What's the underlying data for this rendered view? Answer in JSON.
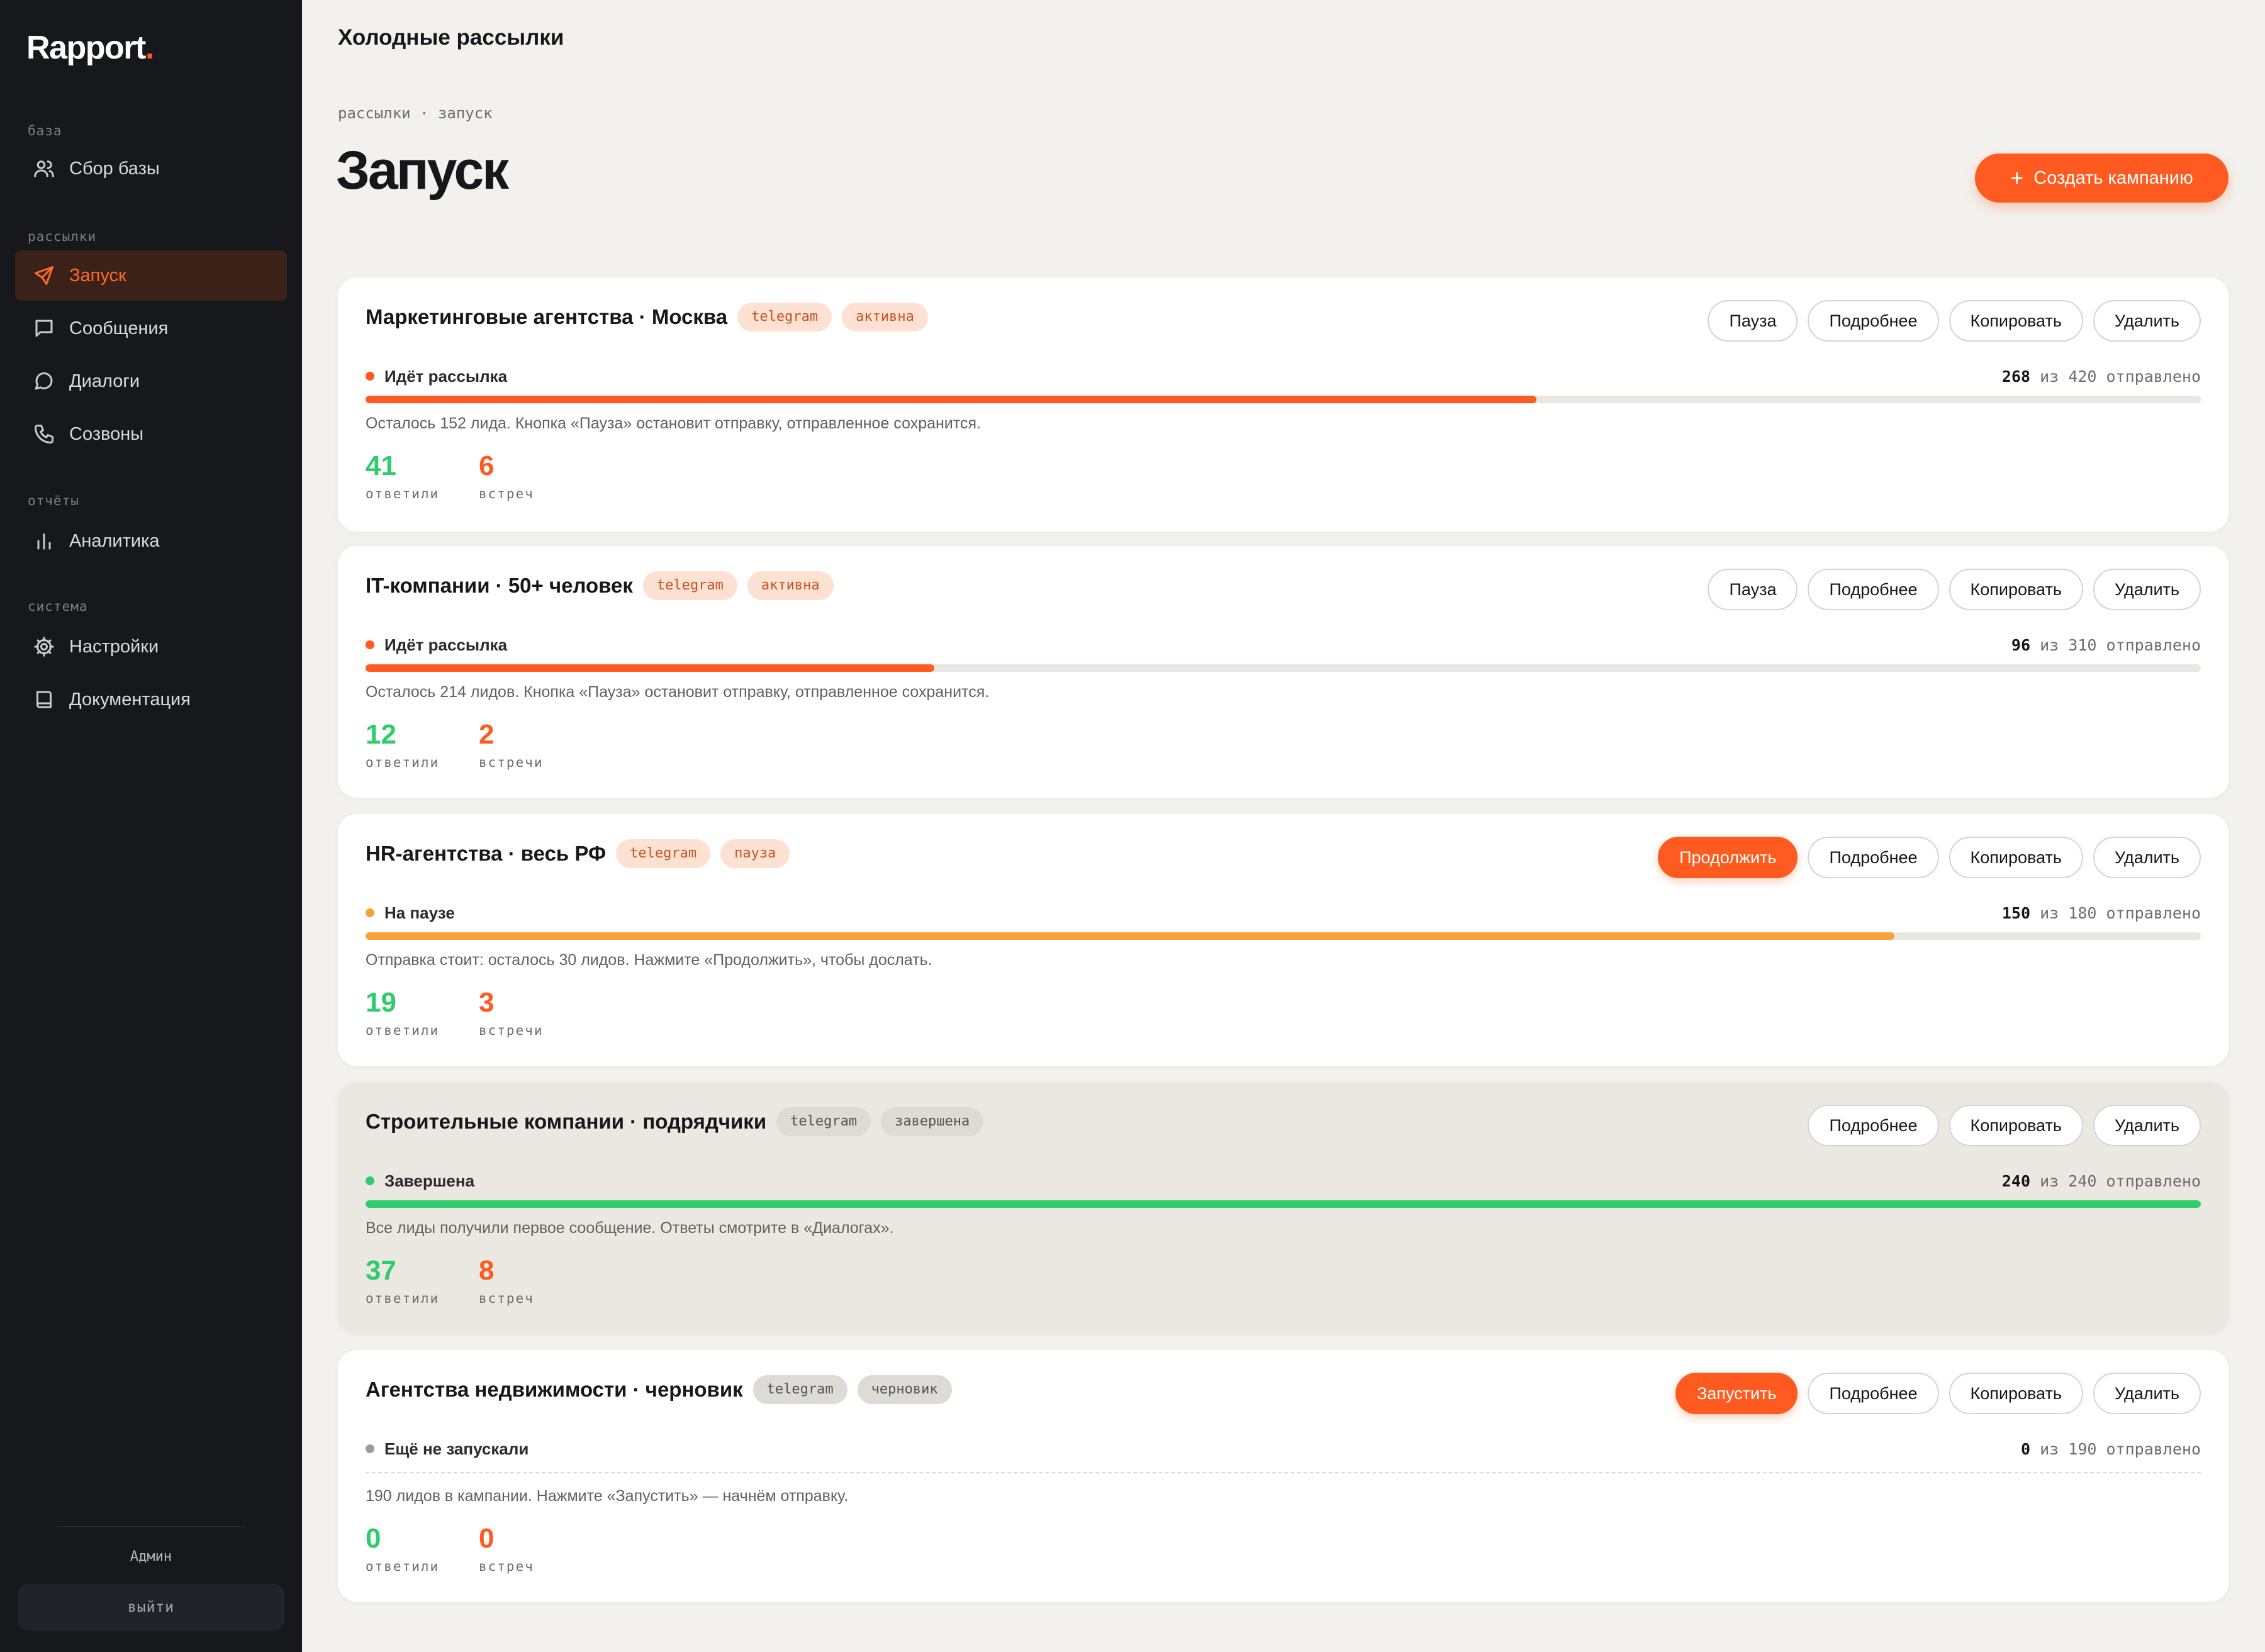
{
  "brand": {
    "name": "Rapport",
    "dot": "."
  },
  "sidebar": {
    "sections": [
      {
        "label": "база",
        "items": [
          {
            "label": "Сбор базы",
            "icon": "users-icon"
          }
        ]
      },
      {
        "label": "рассылки",
        "items": [
          {
            "label": "Запуск",
            "icon": "send-icon",
            "active": true
          },
          {
            "label": "Сообщения",
            "icon": "message-square-icon"
          },
          {
            "label": "Диалоги",
            "icon": "message-circle-icon"
          },
          {
            "label": "Созвоны",
            "icon": "phone-icon"
          }
        ]
      },
      {
        "label": "отчёты",
        "items": [
          {
            "label": "Аналитика",
            "icon": "bar-chart-icon"
          }
        ]
      },
      {
        "label": "система",
        "items": [
          {
            "label": "Настройки",
            "icon": "gear-icon"
          },
          {
            "label": "Документация",
            "icon": "book-icon"
          }
        ]
      }
    ],
    "user": "Админ",
    "logout_label": "выйти"
  },
  "header": {
    "title": "Холодные рассылки",
    "breadcrumb": "рассылки · запуск",
    "page_title": "Запуск",
    "create_label": "Создать кампанию",
    "create_icon": "plus-icon"
  },
  "colors": {
    "accent": "#ff5a1f",
    "green": "#2ecc6b",
    "amber": "#f7a23b",
    "gray": "#9a9ca1"
  },
  "campaigns": [
    {
      "name": "Маркетинговые агентства · Москва",
      "channel": "telegram",
      "status_chip": "активна",
      "primary_action": "Пауза",
      "status": "Идёт рассылка",
      "sent": "268",
      "total": "420",
      "of": "из",
      "sent_label": "отправлено",
      "progress": 0.638,
      "note": "Осталось 152 лида. Кнопка «Пауза» остановит отправку, отправленное сохранится.",
      "replied": "41",
      "replied_label": "ответили",
      "meetings": "6",
      "meetings_label": "встреч"
    },
    {
      "name": "IT-компании · 50+ человек",
      "channel": "telegram",
      "status_chip": "активна",
      "primary_action": "Пауза",
      "status": "Идёт рассылка",
      "sent": "96",
      "total": "310",
      "of": "из",
      "sent_label": "отправлено",
      "progress": 0.31,
      "note": "Осталось 214 лидов. Кнопка «Пауза» остановит отправку, отправленное сохранится.",
      "replied": "12",
      "replied_label": "ответили",
      "meetings": "2",
      "meetings_label": "встречи"
    },
    {
      "name": "HR-агентства · весь РФ",
      "channel": "telegram",
      "status_chip": "пауза",
      "primary_action": "Продолжить",
      "status": "На паузе",
      "sent": "150",
      "total": "180",
      "of": "из",
      "sent_label": "отправлено",
      "progress": 0.833,
      "note": "Отправка стоит: осталось 30 лидов. Нажмите «Продолжить», чтобы дослать.",
      "replied": "19",
      "replied_label": "ответили",
      "meetings": "3",
      "meetings_label": "встречи"
    },
    {
      "name": "Строительные компании · подрядчики",
      "channel": "telegram",
      "status_chip": "завершена",
      "primary_action": "",
      "status": "Завершена",
      "sent": "240",
      "total": "240",
      "of": "из",
      "sent_label": "отправлено",
      "progress": 1.0,
      "note": "Все лиды получили первое сообщение. Ответы смотрите в «Диалогах».",
      "replied": "37",
      "replied_label": "ответили",
      "meetings": "8",
      "meetings_label": "встреч"
    },
    {
      "name": "Агентства недвижимости · черновик",
      "channel": "telegram",
      "status_chip": "черновик",
      "primary_action": "Запустить",
      "status": "Ещё не запускали",
      "sent": "0",
      "total": "190",
      "of": "из",
      "sent_label": "отправлено",
      "progress": 0,
      "note": "190 лидов в кампании. Нажмите «Запустить» — начнём отправку.",
      "replied": "0",
      "replied_label": "ответили",
      "meetings": "0",
      "meetings_label": "встреч"
    }
  ],
  "actions": {
    "details": "Подробнее",
    "copy": "Копировать",
    "delete": "Удалить"
  }
}
